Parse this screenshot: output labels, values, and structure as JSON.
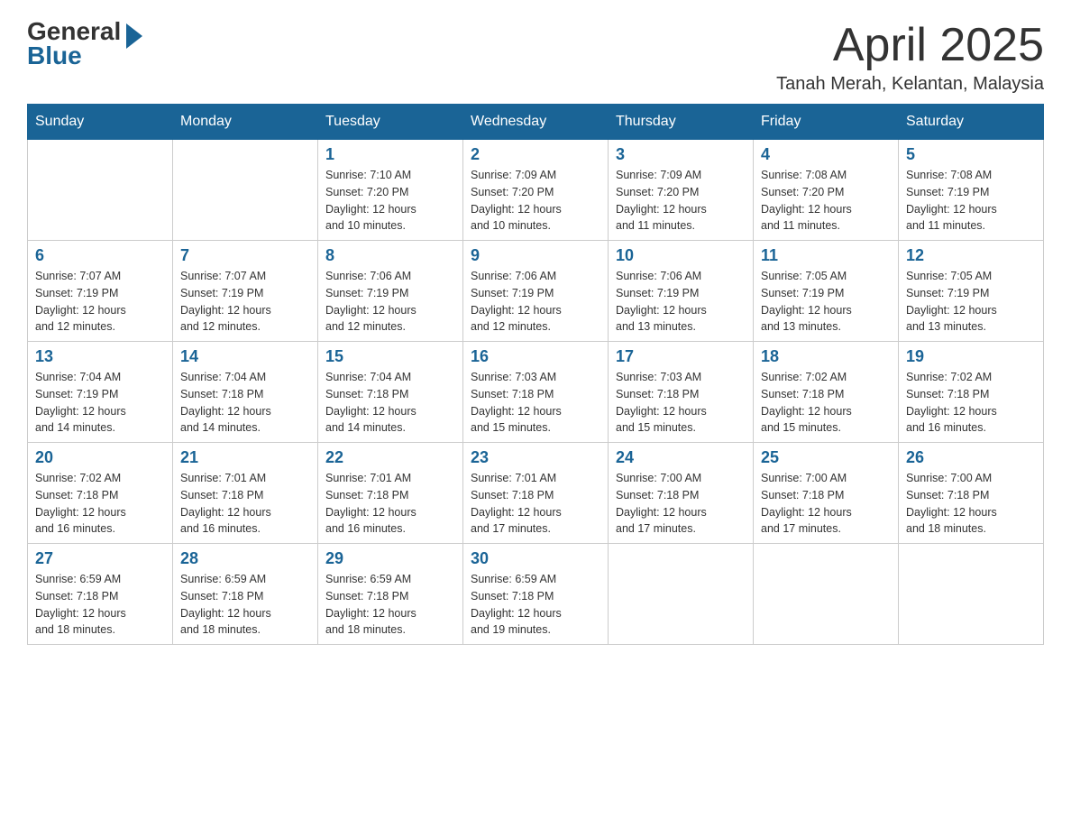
{
  "header": {
    "logo_general": "General",
    "logo_blue": "Blue",
    "month_year": "April 2025",
    "location": "Tanah Merah, Kelantan, Malaysia"
  },
  "days_of_week": [
    "Sunday",
    "Monday",
    "Tuesday",
    "Wednesday",
    "Thursday",
    "Friday",
    "Saturday"
  ],
  "weeks": [
    [
      {
        "day": "",
        "info": ""
      },
      {
        "day": "",
        "info": ""
      },
      {
        "day": "1",
        "info": "Sunrise: 7:10 AM\nSunset: 7:20 PM\nDaylight: 12 hours\nand 10 minutes."
      },
      {
        "day": "2",
        "info": "Sunrise: 7:09 AM\nSunset: 7:20 PM\nDaylight: 12 hours\nand 10 minutes."
      },
      {
        "day": "3",
        "info": "Sunrise: 7:09 AM\nSunset: 7:20 PM\nDaylight: 12 hours\nand 11 minutes."
      },
      {
        "day": "4",
        "info": "Sunrise: 7:08 AM\nSunset: 7:20 PM\nDaylight: 12 hours\nand 11 minutes."
      },
      {
        "day": "5",
        "info": "Sunrise: 7:08 AM\nSunset: 7:19 PM\nDaylight: 12 hours\nand 11 minutes."
      }
    ],
    [
      {
        "day": "6",
        "info": "Sunrise: 7:07 AM\nSunset: 7:19 PM\nDaylight: 12 hours\nand 12 minutes."
      },
      {
        "day": "7",
        "info": "Sunrise: 7:07 AM\nSunset: 7:19 PM\nDaylight: 12 hours\nand 12 minutes."
      },
      {
        "day": "8",
        "info": "Sunrise: 7:06 AM\nSunset: 7:19 PM\nDaylight: 12 hours\nand 12 minutes."
      },
      {
        "day": "9",
        "info": "Sunrise: 7:06 AM\nSunset: 7:19 PM\nDaylight: 12 hours\nand 12 minutes."
      },
      {
        "day": "10",
        "info": "Sunrise: 7:06 AM\nSunset: 7:19 PM\nDaylight: 12 hours\nand 13 minutes."
      },
      {
        "day": "11",
        "info": "Sunrise: 7:05 AM\nSunset: 7:19 PM\nDaylight: 12 hours\nand 13 minutes."
      },
      {
        "day": "12",
        "info": "Sunrise: 7:05 AM\nSunset: 7:19 PM\nDaylight: 12 hours\nand 13 minutes."
      }
    ],
    [
      {
        "day": "13",
        "info": "Sunrise: 7:04 AM\nSunset: 7:19 PM\nDaylight: 12 hours\nand 14 minutes."
      },
      {
        "day": "14",
        "info": "Sunrise: 7:04 AM\nSunset: 7:18 PM\nDaylight: 12 hours\nand 14 minutes."
      },
      {
        "day": "15",
        "info": "Sunrise: 7:04 AM\nSunset: 7:18 PM\nDaylight: 12 hours\nand 14 minutes."
      },
      {
        "day": "16",
        "info": "Sunrise: 7:03 AM\nSunset: 7:18 PM\nDaylight: 12 hours\nand 15 minutes."
      },
      {
        "day": "17",
        "info": "Sunrise: 7:03 AM\nSunset: 7:18 PM\nDaylight: 12 hours\nand 15 minutes."
      },
      {
        "day": "18",
        "info": "Sunrise: 7:02 AM\nSunset: 7:18 PM\nDaylight: 12 hours\nand 15 minutes."
      },
      {
        "day": "19",
        "info": "Sunrise: 7:02 AM\nSunset: 7:18 PM\nDaylight: 12 hours\nand 16 minutes."
      }
    ],
    [
      {
        "day": "20",
        "info": "Sunrise: 7:02 AM\nSunset: 7:18 PM\nDaylight: 12 hours\nand 16 minutes."
      },
      {
        "day": "21",
        "info": "Sunrise: 7:01 AM\nSunset: 7:18 PM\nDaylight: 12 hours\nand 16 minutes."
      },
      {
        "day": "22",
        "info": "Sunrise: 7:01 AM\nSunset: 7:18 PM\nDaylight: 12 hours\nand 16 minutes."
      },
      {
        "day": "23",
        "info": "Sunrise: 7:01 AM\nSunset: 7:18 PM\nDaylight: 12 hours\nand 17 minutes."
      },
      {
        "day": "24",
        "info": "Sunrise: 7:00 AM\nSunset: 7:18 PM\nDaylight: 12 hours\nand 17 minutes."
      },
      {
        "day": "25",
        "info": "Sunrise: 7:00 AM\nSunset: 7:18 PM\nDaylight: 12 hours\nand 17 minutes."
      },
      {
        "day": "26",
        "info": "Sunrise: 7:00 AM\nSunset: 7:18 PM\nDaylight: 12 hours\nand 18 minutes."
      }
    ],
    [
      {
        "day": "27",
        "info": "Sunrise: 6:59 AM\nSunset: 7:18 PM\nDaylight: 12 hours\nand 18 minutes."
      },
      {
        "day": "28",
        "info": "Sunrise: 6:59 AM\nSunset: 7:18 PM\nDaylight: 12 hours\nand 18 minutes."
      },
      {
        "day": "29",
        "info": "Sunrise: 6:59 AM\nSunset: 7:18 PM\nDaylight: 12 hours\nand 18 minutes."
      },
      {
        "day": "30",
        "info": "Sunrise: 6:59 AM\nSunset: 7:18 PM\nDaylight: 12 hours\nand 19 minutes."
      },
      {
        "day": "",
        "info": ""
      },
      {
        "day": "",
        "info": ""
      },
      {
        "day": "",
        "info": ""
      }
    ]
  ],
  "colors": {
    "header_bg": "#1a6496",
    "header_text": "#ffffff",
    "day_number": "#1a6496",
    "border": "#cccccc",
    "text": "#333333"
  }
}
